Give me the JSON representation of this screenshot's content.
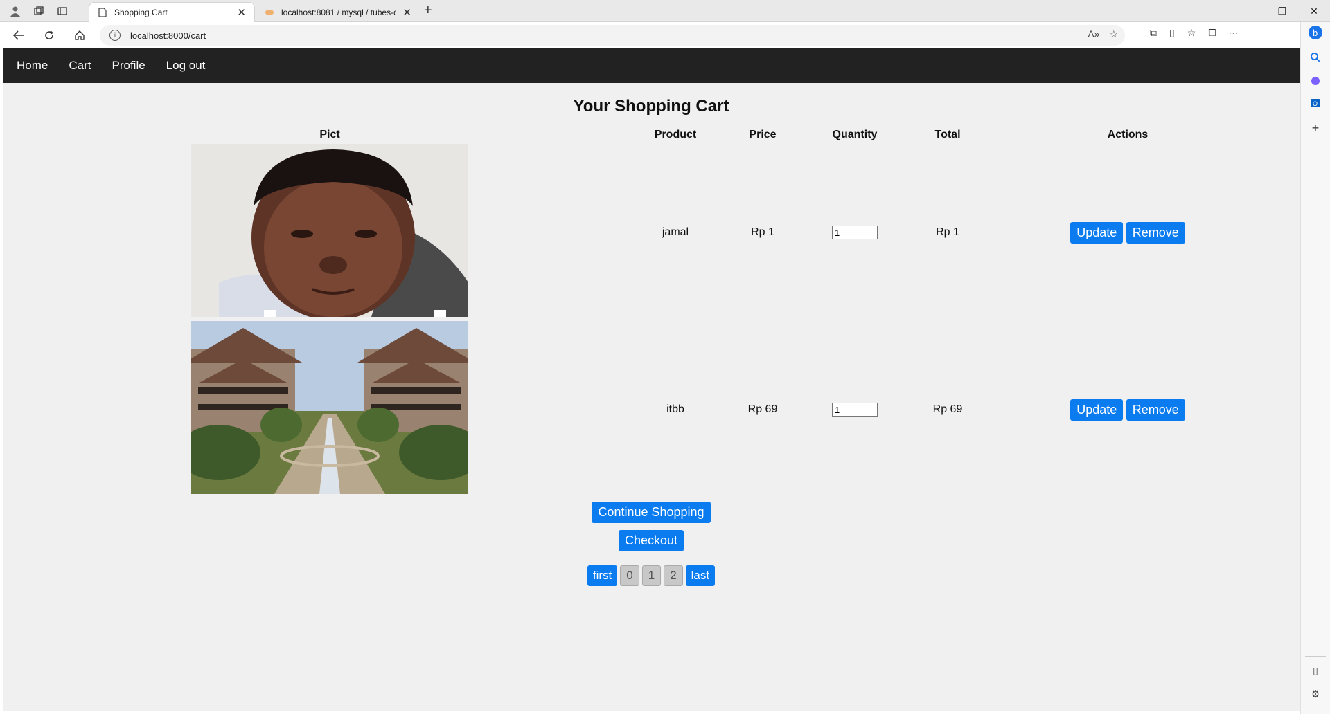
{
  "browser": {
    "tabs": [
      {
        "title": "Shopping Cart",
        "active": true
      },
      {
        "title": "localhost:8081 / mysql / tubes-di",
        "active": false
      }
    ],
    "url": "localhost:8000/cart"
  },
  "navbar": {
    "links": [
      "Home",
      "Cart",
      "Profile",
      "Log out"
    ]
  },
  "page": {
    "title": "Your Shopping Cart"
  },
  "table": {
    "headers": {
      "pict": "Pict",
      "product": "Product",
      "price": "Price",
      "quantity": "Quantity",
      "total": "Total",
      "actions": "Actions"
    },
    "rows": [
      {
        "product": "jamal",
        "price": "Rp 1",
        "quantity": "1",
        "total": "Rp 1",
        "update_label": "Update",
        "remove_label": "Remove"
      },
      {
        "product": "itbb",
        "price": "Rp 69",
        "quantity": "1",
        "total": "Rp 69",
        "update_label": "Update",
        "remove_label": "Remove"
      }
    ]
  },
  "buttons": {
    "continue": "Continue Shopping",
    "checkout": "Checkout"
  },
  "pagination": {
    "first": "first",
    "pages": [
      "0",
      "1",
      "2"
    ],
    "last": "last"
  },
  "colors": {
    "accent": "#0a7cf0",
    "navbar": "#222222",
    "page_bg": "#f0f0f0"
  }
}
